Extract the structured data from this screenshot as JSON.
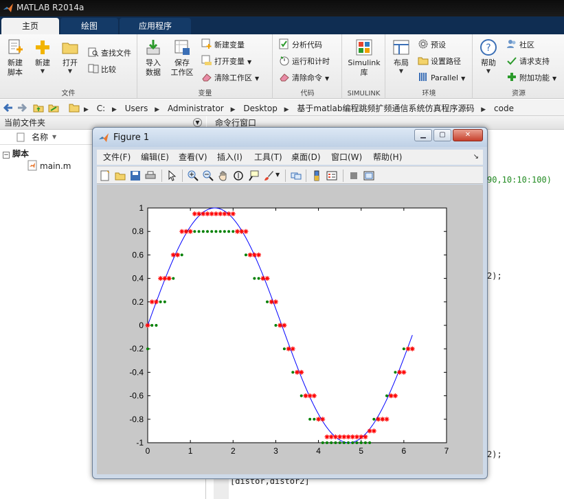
{
  "app": {
    "title": "MATLAB R2014a"
  },
  "tabs": [
    {
      "label": "主页",
      "active": true
    },
    {
      "label": "绘图",
      "active": false
    },
    {
      "label": "应用程序",
      "active": false
    }
  ],
  "ribbon": {
    "file": {
      "group_label": "文件",
      "new_script": "新建\n脚本",
      "new": "新建",
      "open": "打开",
      "find_files": "查找文件",
      "compare": "比较"
    },
    "variable": {
      "group_label": "变量",
      "import_data": "导入\n数据",
      "save_workspace": "保存\n工作区",
      "new_variable": "新建变量",
      "open_variable": "打开变量",
      "clear_workspace": "清除工作区"
    },
    "code": {
      "group_label": "代码",
      "analyze_code": "分析代码",
      "run_and_time": "运行和计时",
      "clear_commands": "清除命令"
    },
    "simulink": {
      "group_label": "SIMULINK",
      "library": "Simulink\n库"
    },
    "environment": {
      "group_label": "环境",
      "layout": "布局",
      "preferences": "预设",
      "set_path": "设置路径",
      "parallel": "Parallel"
    },
    "resources": {
      "group_label": "资源",
      "help": "帮助",
      "community": "社区",
      "request_support": "请求支持",
      "add_ons": "附加功能"
    }
  },
  "address": {
    "crumbs": [
      "C:",
      "Users",
      "Administrator",
      "Desktop",
      "基于matlab编程跳频扩频通信系统仿真程序源码",
      "code"
    ]
  },
  "left_panel": {
    "title": "当前文件夹",
    "column_name": "名称",
    "section": "脚本",
    "files": [
      "main.m"
    ]
  },
  "command_window": {
    "title": "命令行窗口",
    "lines": [
      {
        "text": "90,10:10:100)",
        "color": "green"
      },
      {
        "text": "2);",
        "color": "black"
      },
      {
        "text": "2);",
        "color": "black"
      },
      {
        "text": "[distor,distor2]",
        "color": "black"
      }
    ]
  },
  "figure": {
    "title": "Figure 1",
    "menu": [
      "文件(F)",
      "编辑(E)",
      "查看(V)",
      "插入(I)",
      "工具(T)",
      "桌面(D)",
      "窗口(W)",
      "帮助(H)"
    ],
    "dock_glyph": "↘",
    "colors": {
      "line": "#0000ff",
      "quantized_red": "#ff0000",
      "quantized_green": "#008000",
      "axes_bg": "#ffffff",
      "canvas_bg": "#c8c8c8"
    }
  },
  "chart_data": {
    "type": "line",
    "xlim": [
      0,
      7
    ],
    "ylim": [
      -1,
      1
    ],
    "xticks": [
      "0",
      "1",
      "2",
      "3",
      "4",
      "5",
      "6",
      "7"
    ],
    "yticks": [
      "1",
      "0.8",
      "0.6",
      "0.4",
      "0.2",
      "0",
      "-0.2",
      "-0.4",
      "-0.6",
      "-0.8",
      "-1"
    ],
    "grid": false,
    "series": [
      {
        "style": "line",
        "color": "#0000ff",
        "function": "sin(x)",
        "x_range": [
          0,
          6.2
        ]
      },
      {
        "style": "red-star",
        "color": "#ff0000",
        "x": [
          0.0,
          0.1,
          0.2,
          0.3,
          0.4,
          0.5,
          0.6,
          0.7,
          0.8,
          0.9,
          1.0,
          1.1,
          1.2,
          1.3,
          1.4,
          1.5,
          1.6,
          1.7,
          1.8,
          1.9,
          2.0,
          2.1,
          2.2,
          2.3,
          2.4,
          2.5,
          2.6,
          2.7,
          2.8,
          2.9,
          3.0,
          3.1,
          3.2,
          3.3,
          3.4,
          3.5,
          3.6,
          3.7,
          3.8,
          3.9,
          4.0,
          4.1,
          4.2,
          4.3,
          4.4,
          4.5,
          4.6,
          4.7,
          4.8,
          4.9,
          5.0,
          5.1,
          5.2,
          5.3,
          5.4,
          5.5,
          5.6,
          5.7,
          5.8,
          5.9,
          6.0,
          6.1,
          6.2
        ],
        "y": [
          0,
          0.2,
          0.2,
          0.4,
          0.4,
          0.4,
          0.6,
          0.6,
          0.8,
          0.8,
          0.8,
          0.95,
          0.95,
          0.95,
          0.95,
          0.95,
          0.95,
          0.95,
          0.95,
          0.95,
          0.95,
          0.8,
          0.8,
          0.8,
          0.6,
          0.6,
          0.6,
          0.4,
          0.4,
          0.2,
          0.2,
          0,
          0,
          -0.2,
          -0.2,
          -0.4,
          -0.4,
          -0.6,
          -0.6,
          -0.6,
          -0.8,
          -0.8,
          -0.95,
          -0.95,
          -0.95,
          -0.95,
          -0.95,
          -0.95,
          -0.95,
          -0.95,
          -0.95,
          -0.95,
          -0.9,
          -0.9,
          -0.8,
          -0.8,
          -0.8,
          -0.6,
          -0.6,
          -0.4,
          -0.4,
          -0.2,
          -0.2
        ]
      },
      {
        "style": "green-dot",
        "color": "#008000",
        "x": [
          0.0,
          0.1,
          0.2,
          0.3,
          0.4,
          0.5,
          0.6,
          0.7,
          0.8,
          0.9,
          1.0,
          1.1,
          1.2,
          1.3,
          1.4,
          1.5,
          1.6,
          1.7,
          1.8,
          1.9,
          2.0,
          2.1,
          2.2,
          2.3,
          2.4,
          2.5,
          2.6,
          2.7,
          2.8,
          2.9,
          3.0,
          3.1,
          3.2,
          3.3,
          3.4,
          3.5,
          3.6,
          3.7,
          3.8,
          3.9,
          4.0,
          4.1,
          4.2,
          4.3,
          4.4,
          4.5,
          4.6,
          4.7,
          4.8,
          4.9,
          5.0,
          5.1,
          5.2,
          5.3,
          5.4,
          5.5,
          5.6,
          5.7,
          5.8,
          5.9,
          6.0,
          6.1,
          6.2
        ],
        "y": [
          -0.2,
          0,
          0,
          0.2,
          0.2,
          0.4,
          0.4,
          0.6,
          0.6,
          0.8,
          0.8,
          0.8,
          0.8,
          0.8,
          0.8,
          0.8,
          0.8,
          0.8,
          0.8,
          0.8,
          0.8,
          0.8,
          0.8,
          0.6,
          0.6,
          0.4,
          0.4,
          0.4,
          0.2,
          0.2,
          0,
          0,
          -0.2,
          -0.2,
          -0.4,
          -0.4,
          -0.6,
          -0.6,
          -0.8,
          -0.8,
          -0.8,
          -1,
          -1,
          -1,
          -1,
          -1,
          -1,
          -1,
          -1,
          -1,
          -1,
          -1,
          -1,
          -0.8,
          -0.8,
          -0.8,
          -0.6,
          -0.6,
          -0.4,
          -0.4,
          -0.2,
          -0.2,
          -0.2
        ]
      }
    ]
  }
}
